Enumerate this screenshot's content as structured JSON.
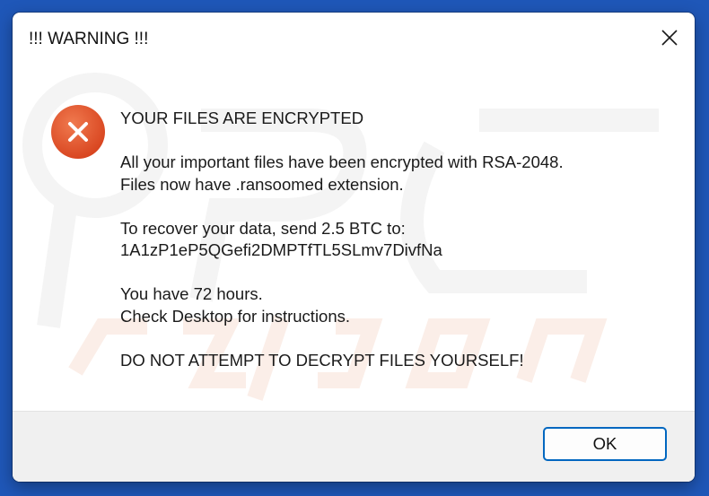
{
  "window": {
    "title": "!!! WARNING !!!"
  },
  "icons": {
    "close": "close-icon",
    "error": "error-icon"
  },
  "message": {
    "heading": "YOUR FILES ARE ENCRYPTED",
    "lines": [
      "All your important files have been encrypted with RSA-2048.",
      "Files now have .ransoomed extension.",
      "",
      "To recover your data, send 2.5 BTC to:",
      "1A1zP1eP5QGefi2DMPTfTL5SLmv7DivfNa",
      "",
      "You have 72 hours.",
      "Check Desktop for instructions.",
      "",
      "DO NOT ATTEMPT TO DECRYPT FILES YOURSELF!"
    ]
  },
  "buttons": {
    "ok_label": "OK"
  },
  "colors": {
    "error_icon_fill": "#e4532b",
    "button_border": "#0067c0",
    "footer_background": "#f0f0f0"
  }
}
